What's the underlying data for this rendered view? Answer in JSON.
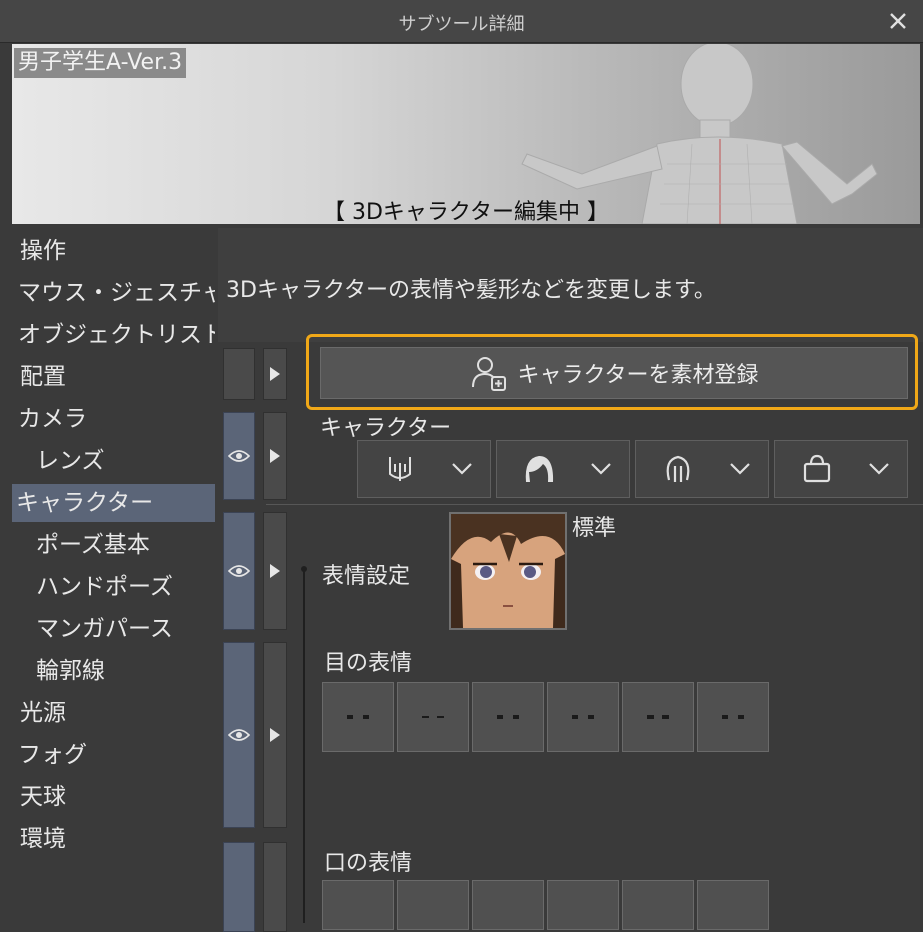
{
  "window": {
    "title": "サブツール詳細",
    "close_icon": "close-icon"
  },
  "preview": {
    "subtool_name": "男子学生A-Ver.3",
    "status": "【 3Dキャラクター編集中 】"
  },
  "sidebar": {
    "items": [
      {
        "label": "操作",
        "level": "top"
      },
      {
        "label": "マウス・ジェスチャー",
        "level": "top"
      },
      {
        "label": "オブジェクトリスト",
        "level": "top"
      },
      {
        "label": "配置",
        "level": "top"
      },
      {
        "label": "カメラ",
        "level": "top"
      },
      {
        "label": "レンズ",
        "level": "sub"
      },
      {
        "label": "キャラクター",
        "level": "top",
        "selected": true
      },
      {
        "label": "ポーズ基本",
        "level": "sub"
      },
      {
        "label": "ハンドポーズ",
        "level": "sub"
      },
      {
        "label": "マンガパース",
        "level": "sub"
      },
      {
        "label": "輪郭線",
        "level": "sub"
      },
      {
        "label": "光源",
        "level": "top"
      },
      {
        "label": "フォグ",
        "level": "top"
      },
      {
        "label": "天球",
        "level": "top"
      },
      {
        "label": "環境",
        "level": "top"
      }
    ],
    "selected_color": "#5b6578"
  },
  "main": {
    "description": "3Dキャラクターの表情や髪形などを変更します。",
    "register_button": "キャラクターを素材登録",
    "highlight_color": "#f0a818",
    "character_section": {
      "label": "キャラクター",
      "dropdowns": [
        {
          "icon": "body-icon"
        },
        {
          "icon": "hair-icon"
        },
        {
          "icon": "head-icon"
        },
        {
          "icon": "bag-icon"
        }
      ]
    },
    "expression": {
      "label": "表情設定",
      "preset_name": "標準",
      "eyes_label": "目の表情",
      "eye_tiles": 6,
      "mouth_label": "口の表情",
      "mouth_tiles": 6
    }
  }
}
